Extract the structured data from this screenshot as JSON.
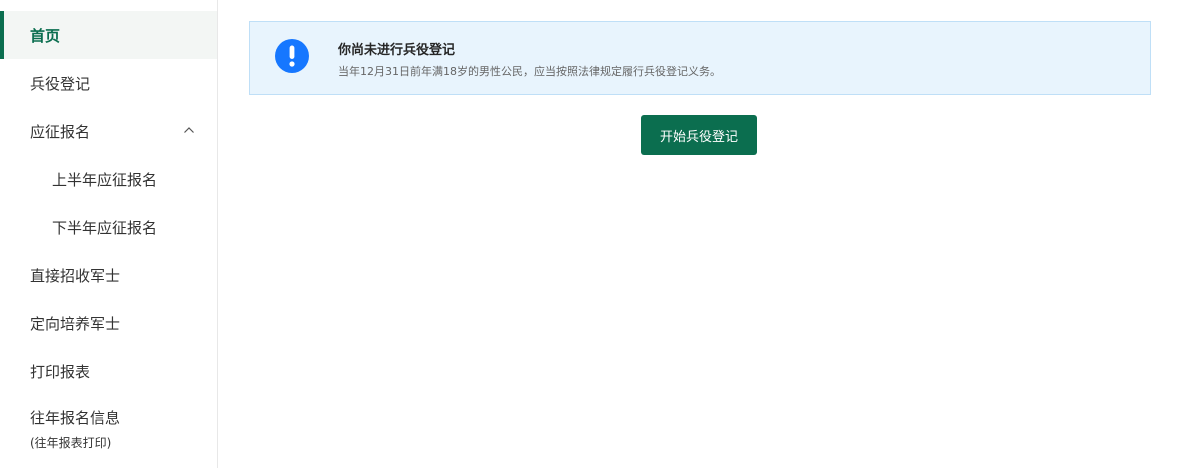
{
  "sidebar": {
    "items": [
      {
        "label": "首页",
        "active": true
      },
      {
        "label": "兵役登记"
      },
      {
        "label": "应征报名",
        "expanded": true,
        "icon": "chevron-up-icon"
      },
      {
        "label": "上半年应征报名"
      },
      {
        "label": "下半年应征报名"
      },
      {
        "label": "直接招收军士"
      },
      {
        "label": "定向培养军士"
      },
      {
        "label": "打印报表"
      },
      {
        "label": "往年报名信息",
        "sublabel": "(往年报表打印)"
      }
    ]
  },
  "alert": {
    "icon": "exclamation-circle-icon",
    "title": "你尚未进行兵役登记",
    "description": "当年12月31日前年满18岁的男性公民，应当按照法律规定履行兵役登记义务。"
  },
  "actions": {
    "start_label": "开始兵役登记"
  },
  "colors": {
    "accent": "#0b6e4f",
    "alert_bg": "#e8f4fd",
    "alert_icon": "#1677ff"
  }
}
